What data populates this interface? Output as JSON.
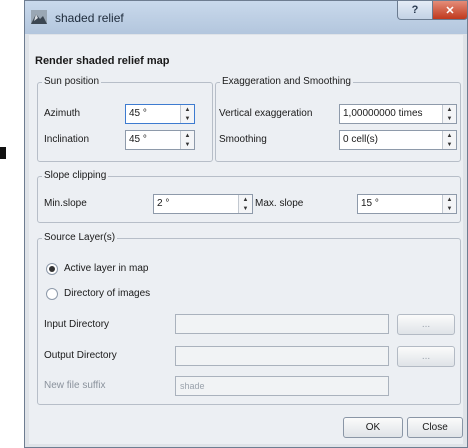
{
  "window": {
    "title": "shaded relief"
  },
  "dialog": {
    "heading": "Render shaded relief map"
  },
  "sun_position": {
    "title": "Sun position",
    "azimuth": {
      "label": "Azimuth",
      "value": "45 °"
    },
    "inclination": {
      "label": "Inclination",
      "value": "45 °"
    }
  },
  "exaggeration": {
    "title": "Exaggeration and Smoothing",
    "vertical": {
      "label": "Vertical exaggeration",
      "value": "1,00000000 times"
    },
    "smoothing": {
      "label": "Smoothing",
      "value": "0 cell(s)"
    }
  },
  "slope_clipping": {
    "title": "Slope clipping",
    "min": {
      "label": "Min.slope",
      "value": "2 °"
    },
    "max": {
      "label": "Max. slope",
      "value": "15 °"
    }
  },
  "source": {
    "title": "Source Layer(s)",
    "option_active": "Active layer in map",
    "option_directory": "Directory of images",
    "input_dir_label": "Input Directory",
    "output_dir_label": "Output Directory",
    "suffix_label": "New file suffix",
    "suffix_value": "shade",
    "browse_label": "..."
  },
  "buttons": {
    "ok": "OK",
    "close": "Close"
  }
}
